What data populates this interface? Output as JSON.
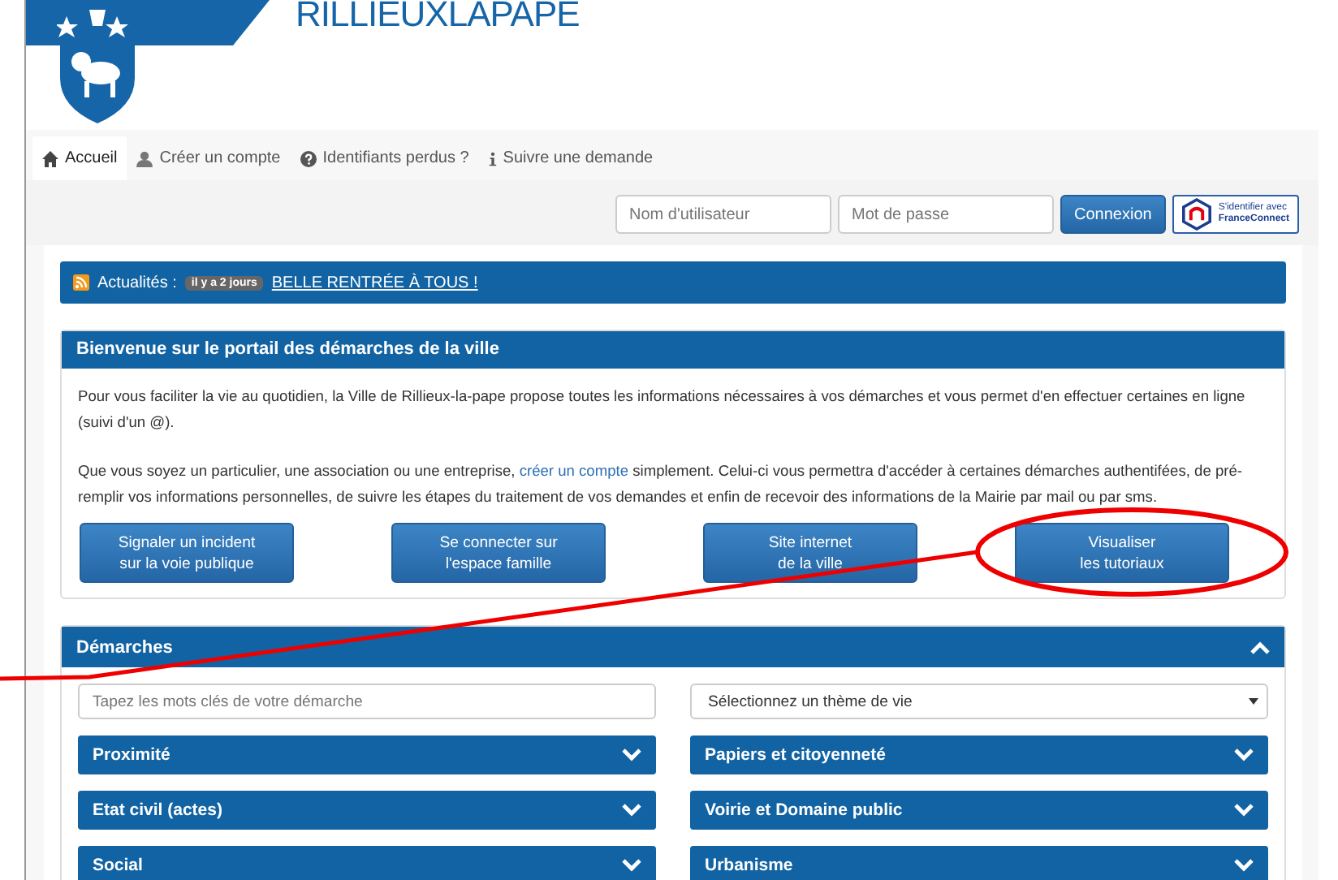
{
  "header": {
    "site_title": "**RILLIEUX**LA**PAPE**"
  },
  "nav_tabs": [
    {
      "label": "Accueil",
      "kind": "home",
      "selected": true
    },
    {
      "label": "Créer un compte",
      "kind": "user",
      "selected": false
    },
    {
      "label": "Identifiants perdus ?",
      "kind": "help",
      "selected": false
    },
    {
      "label": "Suivre une demande",
      "kind": "info",
      "selected": false
    }
  ],
  "login": {
    "username_placeholder": "Nom d'utilisateur",
    "password_placeholder": "Mot de passe",
    "submit": "Connexion",
    "franceconnect": [
      "S'identifier avec",
      "FranceConnect"
    ]
  },
  "news": {
    "label": "Actualités :",
    "badge": "il y a 2 jours",
    "link": "BELLE RENTRÉE À TOUS !"
  },
  "welcome": {
    "title": "Bienvenue sur le portail des démarches de la ville",
    "paragraph_1": "Pour vous faciliter la vie au quotidien, la Ville de Rillieux-la-pape propose toutes les informations nécessaires à vos démarches et vous permet d'en effectuer certaines en ligne (suivi d'un @).",
    "paragraph_2_before": "Que vous soyez un particulier, une association ou une entreprise,",
    "paragraph_2_link": "créer un compte",
    "paragraph_2_after": "simplement. Celui-ci vous permettra d'accéder à certaines démarches authentifées, de pré-remplir vos informations personnelles, de suivre les étapes du traitement de vos demandes et enfin de recevoir des informations de la Mairie par mail ou par sms.",
    "buttons": [
      [
        "Signaler un incident",
        "sur la voie publique"
      ],
      [
        "Se connecter sur",
        "l'espace famille"
      ],
      [
        "Site internet",
        "de la ville"
      ],
      [
        "Visualiser",
        "les tutoriaux"
      ]
    ]
  },
  "demarches": {
    "title": "Démarches",
    "expanded": true,
    "search_placeholder": "Tapez les mots clés de votre démarche",
    "theme_select": "Sélectionnez un thème de vie",
    "categories": [
      {
        "label": "Proximité",
        "expanded": false
      },
      {
        "label": "Papiers et citoyenneté",
        "expanded": false
      },
      {
        "label": "Etat civil (actes)",
        "expanded": false
      },
      {
        "label": "Voirie et Domaine public",
        "expanded": false
      },
      {
        "label": "Social",
        "expanded": false
      },
      {
        "label": "Urbanisme",
        "expanded": false
      }
    ]
  }
}
